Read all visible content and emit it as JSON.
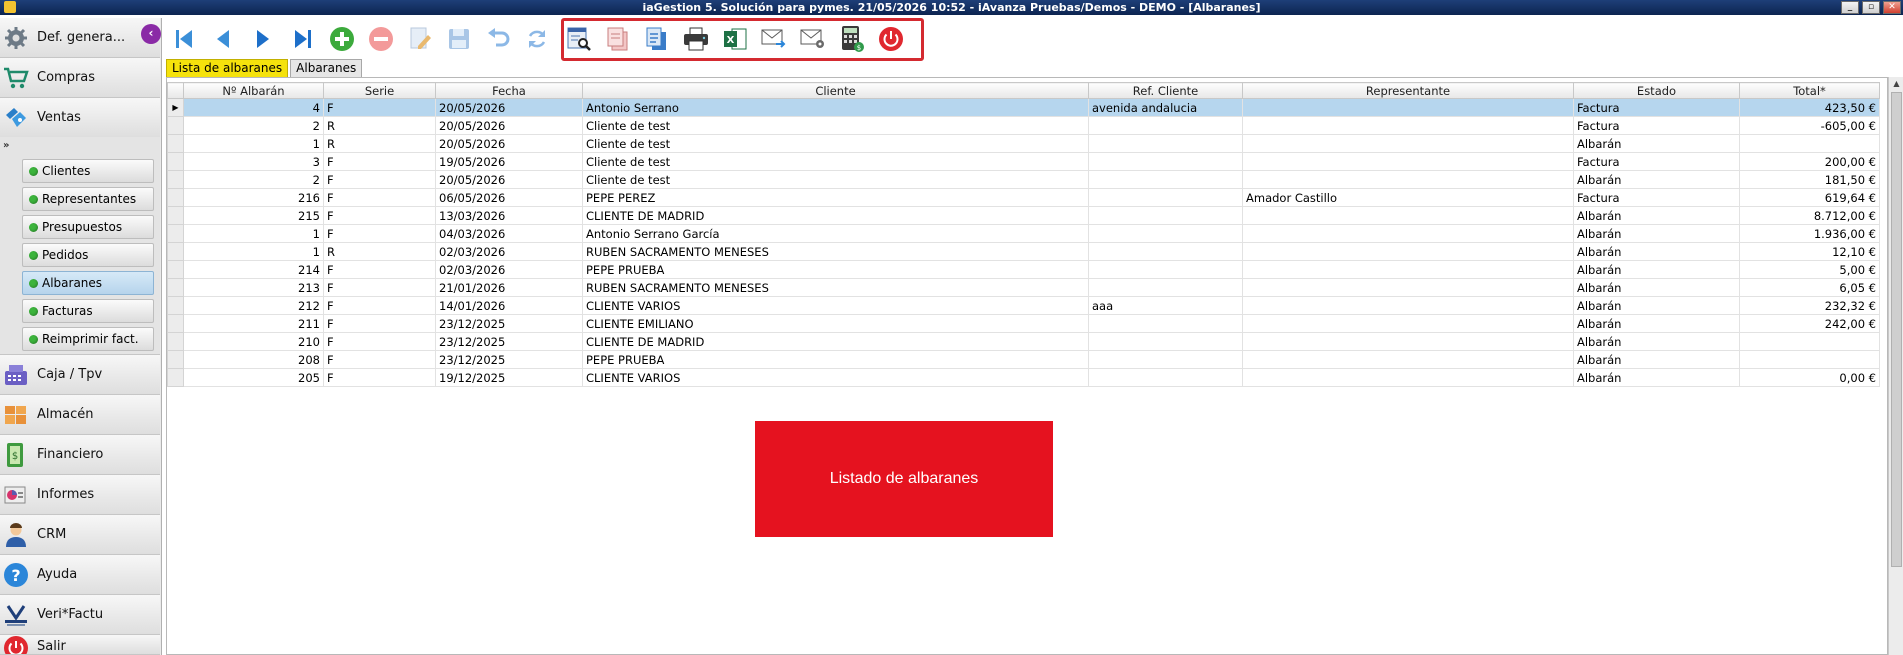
{
  "window": {
    "title": "iaGestion 5. Solución para pymes.  21/05/2026 10:52  -  iAvanza Pruebas/Demos - DEMO - [Albaranes]",
    "buttons": [
      "_",
      "▫",
      "✕"
    ]
  },
  "sidebar": {
    "items": [
      {
        "label": "Def. genera...",
        "icon": "gear-icon"
      },
      {
        "label": "Compras",
        "icon": "shopping-cart-icon"
      },
      {
        "label": "Ventas",
        "icon": "sales-icon"
      },
      {
        "label": "Caja / Tpv",
        "icon": "cash-register-icon"
      },
      {
        "label": "Almacén",
        "icon": "warehouse-icon"
      },
      {
        "label": "Financiero",
        "icon": "money-icon"
      },
      {
        "label": "Informes",
        "icon": "report-icon"
      },
      {
        "label": "CRM",
        "icon": "crm-user-icon"
      },
      {
        "label": "Ayuda",
        "icon": "help-icon"
      },
      {
        "label": "Veri*Factu",
        "icon": "verifactu-icon"
      },
      {
        "label": "Salir",
        "icon": "power-icon"
      }
    ],
    "subitems": [
      {
        "label": "Clientes"
      },
      {
        "label": "Representantes"
      },
      {
        "label": "Presupuestos"
      },
      {
        "label": "Pedidos"
      },
      {
        "label": "Albaranes",
        "active": true
      },
      {
        "label": "Facturas"
      },
      {
        "label": "Reimprimir fact."
      }
    ]
  },
  "tabs": [
    {
      "label": "Lista de albaranes",
      "active": true
    },
    {
      "label": "Albaranes"
    }
  ],
  "grid": {
    "columns": [
      "Nº Albarán",
      "Serie",
      "Fecha",
      "Cliente",
      "Ref. Cliente",
      "Representante",
      "Estado",
      "Total*"
    ],
    "rows": [
      {
        "numero": "4",
        "serie": "F",
        "fecha": "20/05/2026",
        "cliente": "Antonio Serrano",
        "ref": "avenida andalucia",
        "rep": "",
        "estado": "Factura",
        "total": "423,50 €",
        "selected": true
      },
      {
        "numero": "2",
        "serie": "R",
        "fecha": "20/05/2026",
        "cliente": "Cliente de test",
        "ref": "",
        "rep": "",
        "estado": "Factura",
        "total": "-605,00 €"
      },
      {
        "numero": "1",
        "serie": "R",
        "fecha": "20/05/2026",
        "cliente": "Cliente de test",
        "ref": "",
        "rep": "",
        "estado": "Albarán",
        "total": ""
      },
      {
        "numero": "3",
        "serie": "F",
        "fecha": "19/05/2026",
        "cliente": "Cliente de test",
        "ref": "",
        "rep": "",
        "estado": "Factura",
        "total": "200,00 €"
      },
      {
        "numero": "2",
        "serie": "F",
        "fecha": "20/05/2026",
        "cliente": "Cliente de test",
        "ref": "",
        "rep": "",
        "estado": "Albarán",
        "total": "181,50 €"
      },
      {
        "numero": "216",
        "serie": "F",
        "fecha": "06/05/2026",
        "cliente": "PEPE PEREZ",
        "ref": "",
        "rep": "Amador Castillo",
        "estado": "Factura",
        "total": "619,64 €"
      },
      {
        "numero": "215",
        "serie": "F",
        "fecha": "13/03/2026",
        "cliente": "CLIENTE DE MADRID",
        "ref": "",
        "rep": "",
        "estado": "Albarán",
        "total": "8.712,00 €"
      },
      {
        "numero": "1",
        "serie": "F",
        "fecha": "04/03/2026",
        "cliente": "Antonio Serrano García",
        "ref": "",
        "rep": "",
        "estado": "Albarán",
        "total": "1.936,00 €"
      },
      {
        "numero": "1",
        "serie": "R",
        "fecha": "02/03/2026",
        "cliente": "RUBEN SACRAMENTO MENESES",
        "ref": "",
        "rep": "",
        "estado": "Albarán",
        "total": "12,10 €"
      },
      {
        "numero": "214",
        "serie": "F",
        "fecha": "02/03/2026",
        "cliente": "PEPE PRUEBA",
        "ref": "",
        "rep": "",
        "estado": "Albarán",
        "total": "5,00 €"
      },
      {
        "numero": "213",
        "serie": "F",
        "fecha": "21/01/2026",
        "cliente": "RUBEN SACRAMENTO MENESES",
        "ref": "",
        "rep": "",
        "estado": "Albarán",
        "total": "6,05 €"
      },
      {
        "numero": "212",
        "serie": "F",
        "fecha": "14/01/2026",
        "cliente": "CLIENTE VARIOS",
        "ref": "aaa",
        "rep": "",
        "estado": "Albarán",
        "total": "232,32 €"
      },
      {
        "numero": "211",
        "serie": "F",
        "fecha": "23/12/2025",
        "cliente": "CLIENTE EMILIANO",
        "ref": "",
        "rep": "",
        "estado": "Albarán",
        "total": "242,00 €"
      },
      {
        "numero": "210",
        "serie": "F",
        "fecha": "23/12/2025",
        "cliente": "CLIENTE DE MADRID",
        "ref": "",
        "rep": "",
        "estado": "Albarán",
        "total": ""
      },
      {
        "numero": "208",
        "serie": "F",
        "fecha": "23/12/2025",
        "cliente": "PEPE PRUEBA",
        "ref": "",
        "rep": "",
        "estado": "Albarán",
        "total": ""
      },
      {
        "numero": "205",
        "serie": "F",
        "fecha": "19/12/2025",
        "cliente": "CLIENTE VARIOS",
        "ref": "",
        "rep": "",
        "estado": "Albarán",
        "total": "0,00 €"
      }
    ]
  },
  "banner": {
    "text": "Listado de albaranes",
    "color": "#e5121f"
  },
  "colors": {
    "highlight_box": "#d42a30",
    "active_tab": "#f5e20c",
    "selected_row": "#b6d6ee",
    "titlebar": "#0c2450"
  }
}
